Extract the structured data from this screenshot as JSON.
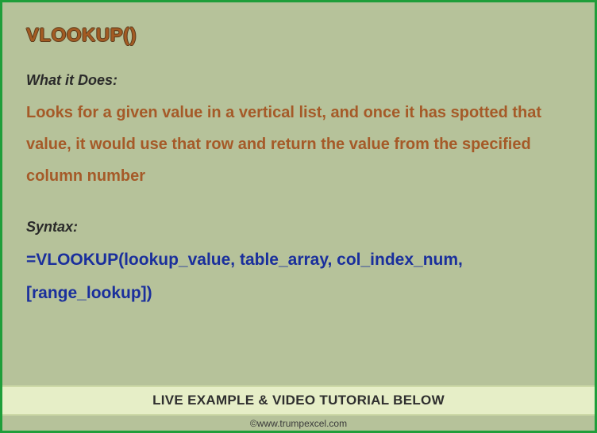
{
  "title": "VLOOKUP()",
  "what_label": "What it Does:",
  "description": "Looks for a given value in a vertical list, and once it has spotted that value, it would use that row and return the value from the specified column number",
  "syntax_label": "Syntax:",
  "syntax": "=VLOOKUP(lookup_value, table_array, col_index_num, [range_lookup])",
  "banner": "LIVE EXAMPLE & VIDEO TUTORIAL BELOW",
  "footer": "©www.trumpexcel.com"
}
